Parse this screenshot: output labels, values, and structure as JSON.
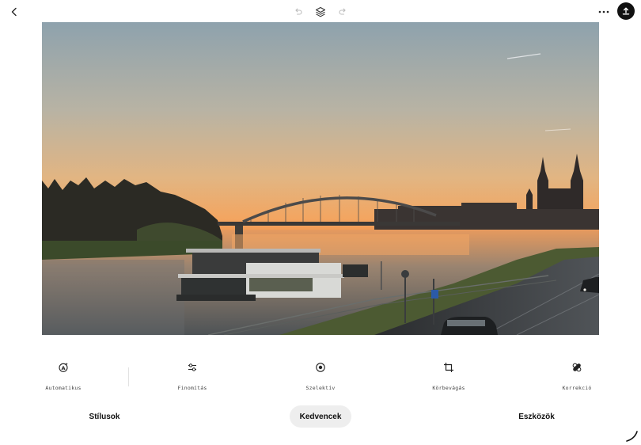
{
  "toolbar": {
    "back_icon": "chevron-left-icon",
    "undo_icon": "undo-icon",
    "layers_icon": "layers-icon",
    "redo_icon": "redo-icon",
    "more_icon": "more-horizontal-icon",
    "export_icon": "upload-icon"
  },
  "tools": [
    {
      "label": "Automatikus",
      "icon": "auto-adjust-icon"
    },
    {
      "label": "Finomítás",
      "icon": "sliders-icon"
    },
    {
      "label": "Szelektív",
      "icon": "selective-icon"
    },
    {
      "label": "Körbevágás",
      "icon": "crop-icon"
    },
    {
      "label": "Korrekció",
      "icon": "healing-bandage-icon"
    }
  ],
  "tabs": [
    {
      "label": "Stílusok",
      "selected": false
    },
    {
      "label": "Kedvencek",
      "selected": true
    },
    {
      "label": "Eszközök",
      "selected": false
    }
  ],
  "colors": {
    "tab_selected_bg": "#eeeeee",
    "export_bg": "#111111"
  }
}
